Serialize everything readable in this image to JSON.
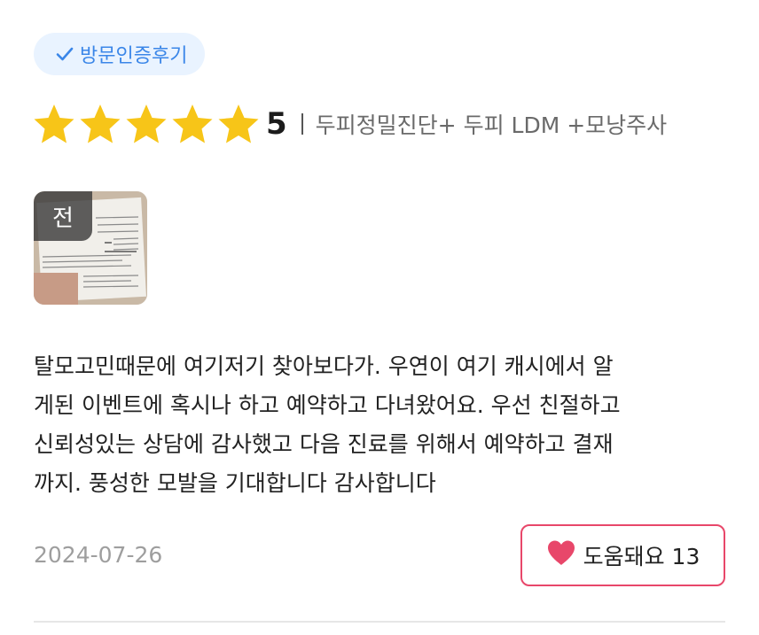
{
  "badge": {
    "label": "방문인증후기",
    "icon": "check-icon",
    "color": "#3a86e8"
  },
  "rating": {
    "stars": 5,
    "score": "5",
    "star_color": "#f7c518"
  },
  "treatment": "두피정밀진단+ 두피 LDM +모낭주사",
  "photo": {
    "tag": "전"
  },
  "review": {
    "lines": [
      "탈모고민때문에 여기저기 찾아보다가. 우연이 여기 캐시에서 알",
      "게된 이벤트에 혹시나 하고 예약하고 다녀왔어요. 우선 친절하고",
      "신뢰성있는 상담에 감사했고 다음 진료를 위해서 예약하고 결재",
      "까지. 풍성한 모발을 기대합니다 감사합니다"
    ]
  },
  "date": "2024-07-26",
  "helpful": {
    "label": "도움돼요 13",
    "icon": "heart-icon",
    "color": "#e8476a"
  }
}
